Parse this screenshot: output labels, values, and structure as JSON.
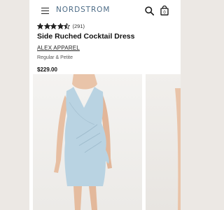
{
  "header": {
    "logo_text": "NORDSTROM",
    "menu_icon": "hamburger-menu-icon",
    "search_icon": "search-icon",
    "bag_icon": "shopping-bag-icon",
    "bag_count": "0",
    "logo_color": "#4c6b86"
  },
  "product": {
    "rating_stars": 4.5,
    "rating_star_color": "#222222",
    "review_count": "(291)",
    "title": "Side Ruched Cocktail Dress",
    "brand": "ALEX APPAREL",
    "variants": "Regular & Petite",
    "price": "$229.00"
  },
  "gallery": {
    "main_image": "light-blue-sleeveless-ruched-dress-photo",
    "dress_color": "#b9d3e2",
    "secondary_image": "partial-product-photo"
  }
}
